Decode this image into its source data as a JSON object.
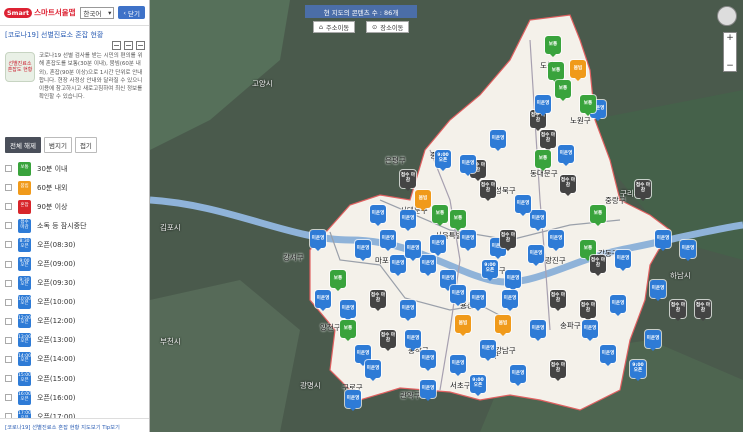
{
  "header": {
    "logo_badge": "Smart",
    "logo_text": "스마트서울맵",
    "language": "한국어",
    "close_label": "닫기"
  },
  "panel": {
    "title": "[코로나19] 선별진료소 혼잡 현황",
    "info_badge": "선별진료소 혼잡도 현황",
    "info_text": "코로나19 선별 검사를 받는 시민의 편의를 위해 혼잡도를 보통(30분 이내), 붐빔(60분 내외), 혼잡(90분 이상)으로 1시간 단위로 안내합니다. 현장 사정상 안내와 달라질 수 있으니 이용에 참고하시고 새로고침하여 최신 정보를 확인할 수 있습니다.",
    "tabs": [
      "전체 해제",
      "범지기",
      "접기"
    ],
    "legend": [
      {
        "badge": "보통",
        "label": "30분 이내",
        "color": "#39a33c"
      },
      {
        "badge": "붐빔",
        "label": "60분 내외",
        "color": "#f09a1a"
      },
      {
        "badge": "혼잡",
        "label": "90분 이상",
        "color": "#d7252a"
      },
      {
        "badge": "접수 마감",
        "label": "소독 등 잠시중단",
        "color": "#2e7bd6"
      },
      {
        "badge": "8:30 오픈",
        "label": "오픈(08:30)",
        "color": "#2e7bd6"
      },
      {
        "badge": "9:00 오픈",
        "label": "오픈(09:00)",
        "color": "#2e7bd6"
      },
      {
        "badge": "9:30 오픈",
        "label": "오픈(09:30)",
        "color": "#2e7bd6"
      },
      {
        "badge": "10:00 오픈",
        "label": "오픈(10:00)",
        "color": "#2e7bd6"
      },
      {
        "badge": "12:00 오픈",
        "label": "오픈(12:00)",
        "color": "#2e7bd6"
      },
      {
        "badge": "13:00 오픈",
        "label": "오픈(13:00)",
        "color": "#2e7bd6"
      },
      {
        "badge": "14:00 오픈",
        "label": "오픈(14:00)",
        "color": "#2e7bd6"
      },
      {
        "badge": "15:00 오픈",
        "label": "오픈(15:00)",
        "color": "#2e7bd6"
      },
      {
        "badge": "16:00 오픈",
        "label": "오픈(16:00)",
        "color": "#2e7bd6"
      },
      {
        "badge": "17:00 오픈",
        "label": "오픈(17:00)",
        "color": "#2e7bd6"
      }
    ],
    "footer": "[코로나19] 선별진료소 혼잡 현황 지도보기 Tip보기"
  },
  "map": {
    "content_count": "현 지도의 콘텐츠 수 : 86개",
    "address_move": "주소이동",
    "place_move": "장소이동",
    "labels": [
      "고양시",
      "구리시",
      "김포시",
      "부천시",
      "광명시",
      "강서구",
      "양천구",
      "구로구",
      "서대문구",
      "성북구",
      "용산구",
      "동대문구",
      "광진구",
      "송파구",
      "서초구",
      "강남구",
      "성동구",
      "중구",
      "서울특별시청",
      "동작구",
      "강동구",
      "관악구",
      "종로구",
      "마포구",
      "은평구",
      "노원구",
      "도봉구",
      "중랑구",
      "하남시"
    ],
    "markers": [
      {
        "type": "green",
        "text": "보통"
      },
      {
        "type": "orange",
        "text": "붐빔"
      },
      {
        "type": "gray",
        "text": "접수 마감"
      },
      {
        "type": "blue",
        "text": "미운영"
      },
      {
        "type": "blue",
        "text": "9:00 오픈"
      }
    ]
  }
}
